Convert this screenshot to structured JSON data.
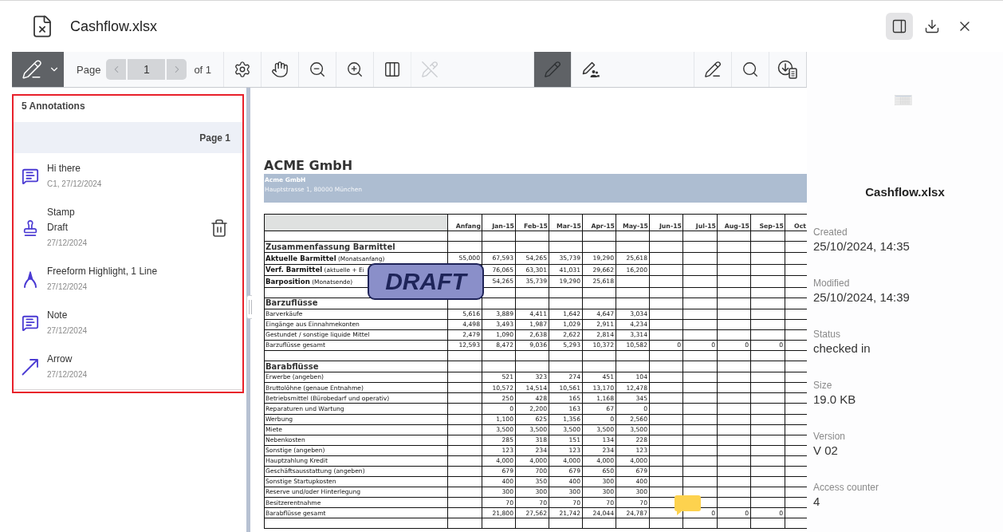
{
  "window": {
    "title": "Cashflow.xlsx"
  },
  "header_actions": [
    {
      "kind": "panel",
      "selected": true
    },
    {
      "kind": "download",
      "selected": false
    },
    {
      "kind": "close",
      "selected": false
    }
  ],
  "toolbar": {
    "annotation_tool": {
      "selected": true
    },
    "pager": {
      "label": "Page",
      "value": "1",
      "total": "of 1",
      "prev_disabled": true,
      "next_disabled": true
    },
    "tool_groups": [
      [
        {
          "kind": "settings",
          "selected": false,
          "disabled": false
        },
        {
          "kind": "pan",
          "selected": false,
          "disabled": false
        },
        {
          "kind": "zoom_out",
          "selected": false,
          "disabled": false
        },
        {
          "kind": "zoom_in",
          "selected": false,
          "disabled": false
        },
        {
          "kind": "columns",
          "selected": false,
          "disabled": false
        },
        {
          "kind": "edit_off",
          "selected": false,
          "disabled": true
        }
      ],
      [
        {
          "kind": "draw",
          "selected": true,
          "disabled": false
        },
        {
          "kind": "draw_shared",
          "selected": false,
          "disabled": false
        }
      ],
      [
        {
          "kind": "sign",
          "selected": false,
          "disabled": false
        },
        {
          "kind": "search",
          "selected": false,
          "disabled": false
        },
        {
          "kind": "export",
          "selected": false,
          "disabled": false
        }
      ]
    ]
  },
  "annotations_panel": {
    "highlighted": true,
    "count_label": "5 Annotations",
    "page_label": "Page 1",
    "items": [
      {
        "kind": "comment",
        "title": "Hi there",
        "meta": "C1, 27/12/2024",
        "hovered": false
      },
      {
        "kind": "stamp",
        "title": "Stamp",
        "detail": "Draft",
        "meta": "27/12/2024",
        "hovered": true
      },
      {
        "kind": "freeform",
        "title": "Freeform Highlight, 1 Line",
        "meta": "27/12/2024",
        "hovered": false
      },
      {
        "kind": "comment",
        "title": "Note",
        "meta": "27/12/2024",
        "hovered": false
      },
      {
        "kind": "arrow",
        "title": "Arrow",
        "meta": "27/12/2024",
        "hovered": false
      }
    ]
  },
  "document": {
    "title": "ACME GmbH",
    "letterhead": {
      "name": "Acme GmbH",
      "address": "Hauptstrasse 1, 80000 München"
    },
    "columns": [
      "Anfang",
      "Jan-15",
      "Feb-15",
      "Mar-15",
      "Apr-15",
      "May-15",
      "Jun-15",
      "Jul-15",
      "Aug-15",
      "Sep-15",
      "Oct"
    ],
    "rows": [
      {
        "kind": "blank"
      },
      {
        "kind": "section",
        "label": "Zusammenfassung Barmittel"
      },
      {
        "kind": "summary",
        "label": "**Aktuelle Barmittel** (Monatsanfang)",
        "cells": [
          {
            "kind": "number",
            "value": "55,000"
          },
          {
            "kind": "number",
            "value": "67,593"
          },
          {
            "kind": "number",
            "value": "54,265"
          },
          {
            "kind": "number",
            "value": "35,739"
          },
          {
            "kind": "number",
            "value": "19,290"
          },
          {
            "kind": "number",
            "value": "25,618"
          }
        ]
      },
      {
        "kind": "summary",
        "label": "**Verf. Barmittel** (aktuelle + Ei",
        "cells": [
          {
            "kind": "empty"
          },
          {
            "kind": "number",
            "value": "76,065"
          },
          {
            "kind": "number",
            "value": "63,301"
          },
          {
            "kind": "number",
            "value": "41,031"
          },
          {
            "kind": "number",
            "value": "29,662"
          },
          {
            "kind": "number",
            "value": "16,200"
          }
        ]
      },
      {
        "kind": "summary",
        "label": "**Barposition** (Monatsende)",
        "cells": [
          {
            "kind": "empty"
          },
          {
            "kind": "number",
            "value": "54,265"
          },
          {
            "kind": "number",
            "value": "35,739"
          },
          {
            "kind": "number",
            "value": "19,290"
          },
          {
            "kind": "number",
            "value": "25,618"
          }
        ]
      },
      {
        "kind": "blank"
      },
      {
        "kind": "section",
        "label": "Barzuflüsse"
      },
      {
        "kind": "item",
        "label": "Barverkäufe",
        "cells": [
          {
            "kind": "number",
            "value": "5,616"
          },
          {
            "kind": "number",
            "value": "3,889"
          },
          {
            "kind": "number",
            "value": "4,411"
          },
          {
            "kind": "number",
            "value": "1,642"
          },
          {
            "kind": "number",
            "value": "4,647"
          },
          {
            "kind": "number",
            "value": "3,034"
          }
        ]
      },
      {
        "kind": "item",
        "label": "Eingänge aus Einnahmekonten",
        "cells": [
          {
            "kind": "number",
            "value": "4,498"
          },
          {
            "kind": "number",
            "value": "3,493"
          },
          {
            "kind": "number",
            "value": "1,987"
          },
          {
            "kind": "number",
            "value": "1,029"
          },
          {
            "kind": "number",
            "value": "2,911"
          },
          {
            "kind": "number",
            "value": "4,234"
          }
        ]
      },
      {
        "kind": "item",
        "label": "Gestundet / sonstige liquide Mittel",
        "cells": [
          {
            "kind": "number",
            "value": "2,479"
          },
          {
            "kind": "number",
            "value": "1,090"
          },
          {
            "kind": "number",
            "value": "2,638"
          },
          {
            "kind": "number",
            "value": "2,622"
          },
          {
            "kind": "number",
            "value": "2,814"
          },
          {
            "kind": "number",
            "value": "3,314"
          }
        ]
      },
      {
        "kind": "item",
        "label": "Barzuflüsse gesamt",
        "cells": [
          {
            "kind": "number",
            "value": "12,593"
          },
          {
            "kind": "number",
            "value": "8,472"
          },
          {
            "kind": "number",
            "value": "9,036"
          },
          {
            "kind": "number",
            "value": "5,293"
          },
          {
            "kind": "number",
            "value": "10,372"
          },
          {
            "kind": "number",
            "value": "10,582"
          },
          {
            "kind": "number",
            "value": "0"
          },
          {
            "kind": "number",
            "value": "0"
          },
          {
            "kind": "number",
            "value": "0"
          },
          {
            "kind": "number",
            "value": "0"
          }
        ]
      },
      {
        "kind": "blank"
      },
      {
        "kind": "section",
        "label": "Barabflüsse"
      },
      {
        "kind": "item",
        "label": "Erwerbe (angeben)",
        "cells": [
          {
            "kind": "empty"
          },
          {
            "kind": "number",
            "value": "521"
          },
          {
            "kind": "number",
            "value": "323"
          },
          {
            "kind": "number",
            "value": "274"
          },
          {
            "kind": "number",
            "value": "451"
          },
          {
            "kind": "number",
            "value": "104"
          }
        ]
      },
      {
        "kind": "item",
        "label": "Bruttolöhne (genaue Entnahme)",
        "cells": [
          {
            "kind": "empty"
          },
          {
            "kind": "number",
            "value": "10,572"
          },
          {
            "kind": "number",
            "value": "14,514"
          },
          {
            "kind": "number",
            "value": "10,561"
          },
          {
            "kind": "number",
            "value": "13,170"
          },
          {
            "kind": "number",
            "value": "12,478"
          }
        ]
      },
      {
        "kind": "item",
        "label": "Betriebsmittel (Bürobedarf und operativ)",
        "cells": [
          {
            "kind": "empty"
          },
          {
            "kind": "number",
            "value": "250"
          },
          {
            "kind": "number",
            "value": "428"
          },
          {
            "kind": "number",
            "value": "165"
          },
          {
            "kind": "number",
            "value": "1,168"
          },
          {
            "kind": "number",
            "value": "345"
          }
        ]
      },
      {
        "kind": "item",
        "label": "Reparaturen und Wartung",
        "cells": [
          {
            "kind": "empty"
          },
          {
            "kind": "number",
            "value": "0"
          },
          {
            "kind": "number",
            "value": "2,200"
          },
          {
            "kind": "number",
            "value": "163"
          },
          {
            "kind": "number",
            "value": "67"
          },
          {
            "kind": "number",
            "value": "0"
          }
        ]
      },
      {
        "kind": "item",
        "label": "Werbung",
        "cells": [
          {
            "kind": "empty"
          },
          {
            "kind": "number",
            "value": "1,100"
          },
          {
            "kind": "number",
            "value": "625"
          },
          {
            "kind": "number",
            "value": "1,356"
          },
          {
            "kind": "number",
            "value": "0"
          },
          {
            "kind": "number",
            "value": "2,560"
          }
        ]
      },
      {
        "kind": "item",
        "label": "Miete",
        "cells": [
          {
            "kind": "empty"
          },
          {
            "kind": "number",
            "value": "3,500"
          },
          {
            "kind": "number",
            "value": "3,500"
          },
          {
            "kind": "number",
            "value": "3,500"
          },
          {
            "kind": "number",
            "value": "3,500"
          },
          {
            "kind": "number",
            "value": "3,500"
          }
        ]
      },
      {
        "kind": "item",
        "label": "Nebenkosten",
        "cells": [
          {
            "kind": "empty"
          },
          {
            "kind": "number",
            "value": "285"
          },
          {
            "kind": "number",
            "value": "318"
          },
          {
            "kind": "number",
            "value": "151"
          },
          {
            "kind": "number",
            "value": "134"
          },
          {
            "kind": "number",
            "value": "228"
          }
        ]
      },
      {
        "kind": "item",
        "label": "Sonstige (angeben)",
        "cells": [
          {
            "kind": "empty"
          },
          {
            "kind": "number",
            "value": "123"
          },
          {
            "kind": "number",
            "value": "234"
          },
          {
            "kind": "number",
            "value": "123"
          },
          {
            "kind": "number",
            "value": "234"
          },
          {
            "kind": "number",
            "value": "123"
          }
        ]
      },
      {
        "kind": "item",
        "label": "Hauptzahlung Kredit",
        "cells": [
          {
            "kind": "empty"
          },
          {
            "kind": "number",
            "value": "4,000"
          },
          {
            "kind": "number",
            "value": "4,000"
          },
          {
            "kind": "number",
            "value": "4,000"
          },
          {
            "kind": "number",
            "value": "4,000"
          },
          {
            "kind": "number",
            "value": "4,000"
          }
        ]
      },
      {
        "kind": "item",
        "label": "Geschäftsausstattung (angeben)",
        "cells": [
          {
            "kind": "empty"
          },
          {
            "kind": "number",
            "value": "679"
          },
          {
            "kind": "number",
            "value": "700"
          },
          {
            "kind": "number",
            "value": "679"
          },
          {
            "kind": "number",
            "value": "650"
          },
          {
            "kind": "number",
            "value": "679"
          }
        ]
      },
      {
        "kind": "item",
        "label": "Sonstige Startupkosten",
        "cells": [
          {
            "kind": "empty"
          },
          {
            "kind": "number",
            "value": "400"
          },
          {
            "kind": "number",
            "value": "350"
          },
          {
            "kind": "number",
            "value": "400"
          },
          {
            "kind": "number",
            "value": "300"
          },
          {
            "kind": "number",
            "value": "400"
          }
        ]
      },
      {
        "kind": "item",
        "label": "Reserve und/oder Hinterlegung",
        "cells": [
          {
            "kind": "empty"
          },
          {
            "kind": "number",
            "value": "300"
          },
          {
            "kind": "number",
            "value": "300"
          },
          {
            "kind": "number",
            "value": "300"
          },
          {
            "kind": "number",
            "value": "300"
          },
          {
            "kind": "number",
            "value": "300"
          }
        ]
      },
      {
        "kind": "item",
        "label": "Besitzerentnahme",
        "cells": [
          {
            "kind": "empty"
          },
          {
            "kind": "number",
            "value": "70"
          },
          {
            "kind": "number",
            "value": "70"
          },
          {
            "kind": "number",
            "value": "70"
          },
          {
            "kind": "number",
            "value": "70"
          },
          {
            "kind": "number",
            "value": "70"
          }
        ]
      },
      {
        "kind": "item",
        "label": "Barabflüsse gesamt",
        "cells": [
          {
            "kind": "empty"
          },
          {
            "kind": "number",
            "value": "21,800"
          },
          {
            "kind": "number",
            "value": "27,562"
          },
          {
            "kind": "number",
            "value": "21,742"
          },
          {
            "kind": "number",
            "value": "24,044"
          },
          {
            "kind": "number",
            "value": "24,787"
          },
          {
            "kind": "empty"
          },
          {
            "kind": "number",
            "value": "0"
          },
          {
            "kind": "number",
            "value": "0"
          },
          {
            "kind": "number",
            "value": "0"
          }
        ]
      },
      {
        "kind": "blank"
      }
    ],
    "overlays": [
      {
        "kind": "stamp",
        "text": "DRAFT"
      },
      {
        "kind": "note"
      }
    ]
  },
  "details": {
    "name": "Cashflow.xlsx",
    "fields": [
      {
        "label": "Created",
        "value": "25/10/2024, 14:35"
      },
      {
        "label": "Modified",
        "value": "25/10/2024, 14:39"
      },
      {
        "label": "Status",
        "value": "checked in"
      },
      {
        "label": "Size",
        "value": "19.0 KB"
      },
      {
        "label": "Version",
        "value": "V 02"
      },
      {
        "label": "Access counter",
        "value": "4"
      }
    ]
  }
}
